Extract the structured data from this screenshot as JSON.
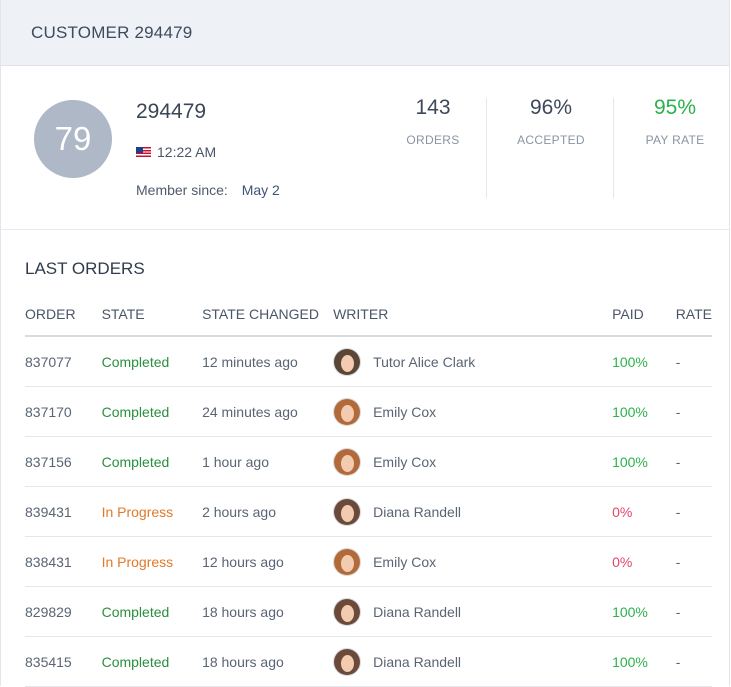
{
  "header": {
    "title": "CUSTOMER 294479"
  },
  "profile": {
    "avatar_text": "79",
    "name": "294479",
    "local_time": "12:22 AM",
    "member_since_label": "Member since:",
    "member_since_value": "May 2"
  },
  "stats": [
    {
      "value": "143",
      "label": "ORDERS"
    },
    {
      "value": "96%",
      "label": "ACCEPTED"
    },
    {
      "value": "95%",
      "label": "PAY RATE"
    }
  ],
  "orders": {
    "title": "LAST ORDERS",
    "columns": [
      "ORDER",
      "STATE",
      "STATE CHANGED",
      "WRITER",
      "PAID",
      "RATE"
    ],
    "rows": [
      {
        "order": "837077",
        "state": "Completed",
        "changed": "12 minutes ago",
        "writer": "Tutor Alice Clark",
        "paid": "100%",
        "rate": "-"
      },
      {
        "order": "837170",
        "state": "Completed",
        "changed": "24 minutes ago",
        "writer": "Emily Cox",
        "paid": "100%",
        "rate": "-"
      },
      {
        "order": "837156",
        "state": "Completed",
        "changed": "1 hour ago",
        "writer": "Emily Cox",
        "paid": "100%",
        "rate": "-"
      },
      {
        "order": "839431",
        "state": "In Progress",
        "changed": "2 hours ago",
        "writer": "Diana Randell",
        "paid": "0%",
        "rate": "-"
      },
      {
        "order": "838431",
        "state": "In Progress",
        "changed": "12 hours ago",
        "writer": "Emily Cox",
        "paid": "0%",
        "rate": "-"
      },
      {
        "order": "829829",
        "state": "Completed",
        "changed": "18 hours ago",
        "writer": "Diana Randell",
        "paid": "100%",
        "rate": "-"
      },
      {
        "order": "835415",
        "state": "Completed",
        "changed": "18 hours ago",
        "writer": "Diana Randell",
        "paid": "100%",
        "rate": "-"
      }
    ]
  }
}
